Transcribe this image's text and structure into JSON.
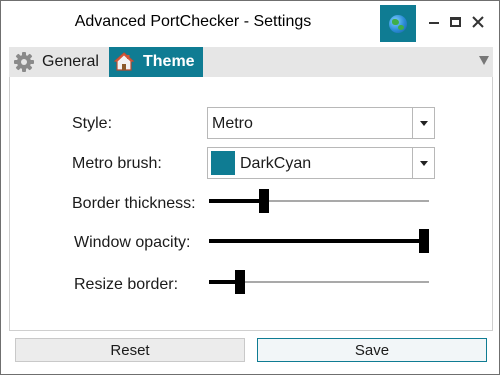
{
  "window": {
    "title": "Advanced PortChecker - Settings",
    "accent_color": "#0f7c93",
    "app_icon": "globe-icon",
    "controls": [
      "minimize-icon",
      "maximize-icon",
      "close-icon"
    ]
  },
  "tabs": [
    {
      "label": "General",
      "icon": "gear-icon",
      "selected": false
    },
    {
      "label": "Theme",
      "icon": "home-icon",
      "selected": true
    }
  ],
  "theme": {
    "style_label": "Style:",
    "style_value": "Metro",
    "brush_label": "Metro brush:",
    "brush_value": "DarkCyan",
    "brush_color": "#0f7c93",
    "border_label": "Border thickness:",
    "border_value": 0.25,
    "opacity_label": "Window opacity:",
    "opacity_value": 1.0,
    "resize_label": "Resize border:",
    "resize_value": 0.14
  },
  "buttons": {
    "reset": "Reset",
    "save": "Save"
  }
}
